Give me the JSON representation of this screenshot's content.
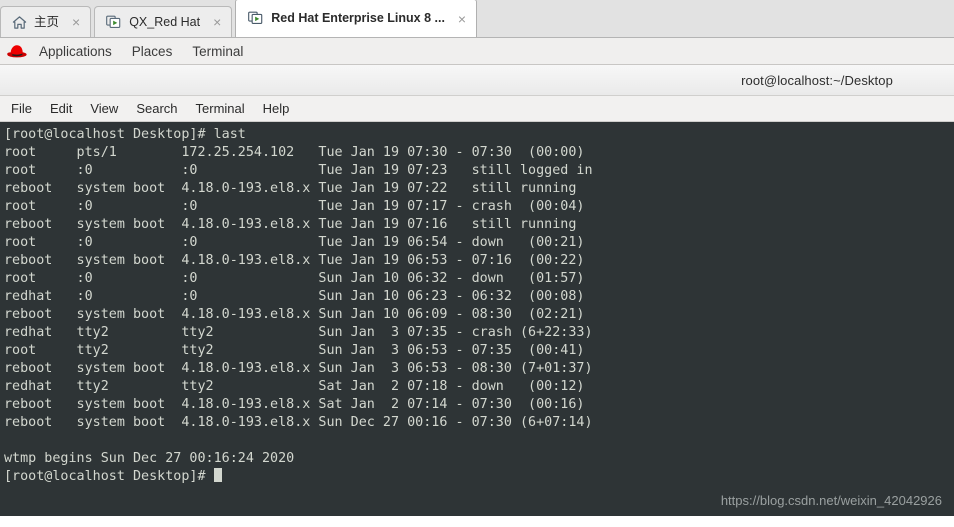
{
  "window": {
    "tabs": [
      {
        "label": "主页",
        "icon": "home-icon",
        "active": false,
        "close_label": "×"
      },
      {
        "label": "QX_Red Hat",
        "icon": "vm-screen-icon",
        "active": false,
        "close_label": "×"
      },
      {
        "label": "Red Hat Enterprise Linux 8 ...",
        "icon": "vm-screen-icon",
        "active": true,
        "close_label": "×"
      }
    ]
  },
  "gnome_panel": {
    "logo": "red-hat-logo",
    "items": [
      {
        "label": "Applications"
      },
      {
        "label": "Places"
      },
      {
        "label": "Terminal"
      }
    ]
  },
  "terminal_window": {
    "title": "root@localhost:~/Desktop",
    "menu": [
      {
        "label": "File"
      },
      {
        "label": "Edit"
      },
      {
        "label": "View"
      },
      {
        "label": "Search"
      },
      {
        "label": "Terminal"
      },
      {
        "label": "Help"
      }
    ]
  },
  "terminal": {
    "background_color": "#2e3436",
    "foreground_color": "#d3d7cf",
    "prompt": "[root@localhost Desktop]#",
    "command": "last",
    "lines": [
      "[root@localhost Desktop]# last",
      "root     pts/1        172.25.254.102   Tue Jan 19 07:30 - 07:30  (00:00)",
      "root     :0           :0               Tue Jan 19 07:23   still logged in",
      "reboot   system boot  4.18.0-193.el8.x Tue Jan 19 07:22   still running",
      "root     :0           :0               Tue Jan 19 07:17 - crash  (00:04)",
      "reboot   system boot  4.18.0-193.el8.x Tue Jan 19 07:16   still running",
      "root     :0           :0               Tue Jan 19 06:54 - down   (00:21)",
      "reboot   system boot  4.18.0-193.el8.x Tue Jan 19 06:53 - 07:16  (00:22)",
      "root     :0           :0               Sun Jan 10 06:32 - down   (01:57)",
      "redhat   :0           :0               Sun Jan 10 06:23 - 06:32  (00:08)",
      "reboot   system boot  4.18.0-193.el8.x Sun Jan 10 06:09 - 08:30  (02:21)",
      "redhat   tty2         tty2             Sun Jan  3 07:35 - crash (6+22:33)",
      "root     tty2         tty2             Sun Jan  3 06:53 - 07:35  (00:41)",
      "reboot   system boot  4.18.0-193.el8.x Sun Jan  3 06:53 - 08:30 (7+01:37)",
      "redhat   tty2         tty2             Sat Jan  2 07:18 - down   (00:12)",
      "reboot   system boot  4.18.0-193.el8.x Sat Jan  2 07:14 - 07:30  (00:16)",
      "reboot   system boot  4.18.0-193.el8.x Sun Dec 27 00:16 - 07:30 (6+07:14)",
      "",
      "wtmp begins Sun Dec 27 00:16:24 2020"
    ],
    "last_entries": [
      {
        "user": "root",
        "tty": "pts/1",
        "host": "172.25.254.102",
        "start": "Tue Jan 19 07:30",
        "end": "07:30",
        "duration": "(00:00)"
      },
      {
        "user": "root",
        "tty": ":0",
        "host": ":0",
        "start": "Tue Jan 19 07:23",
        "end": "still logged in",
        "duration": ""
      },
      {
        "user": "reboot",
        "tty": "system boot",
        "host": "4.18.0-193.el8.x",
        "start": "Tue Jan 19 07:22",
        "end": "still running",
        "duration": ""
      },
      {
        "user": "root",
        "tty": ":0",
        "host": ":0",
        "start": "Tue Jan 19 07:17",
        "end": "crash",
        "duration": "(00:04)"
      },
      {
        "user": "reboot",
        "tty": "system boot",
        "host": "4.18.0-193.el8.x",
        "start": "Tue Jan 19 07:16",
        "end": "still running",
        "duration": ""
      },
      {
        "user": "root",
        "tty": ":0",
        "host": ":0",
        "start": "Tue Jan 19 06:54",
        "end": "down",
        "duration": "(00:21)"
      },
      {
        "user": "reboot",
        "tty": "system boot",
        "host": "4.18.0-193.el8.x",
        "start": "Tue Jan 19 06:53",
        "end": "07:16",
        "duration": "(00:22)"
      },
      {
        "user": "root",
        "tty": ":0",
        "host": ":0",
        "start": "Sun Jan 10 06:32",
        "end": "down",
        "duration": "(01:57)"
      },
      {
        "user": "redhat",
        "tty": ":0",
        "host": ":0",
        "start": "Sun Jan 10 06:23",
        "end": "06:32",
        "duration": "(00:08)"
      },
      {
        "user": "reboot",
        "tty": "system boot",
        "host": "4.18.0-193.el8.x",
        "start": "Sun Jan 10 06:09",
        "end": "08:30",
        "duration": "(02:21)"
      },
      {
        "user": "redhat",
        "tty": "tty2",
        "host": "tty2",
        "start": "Sun Jan  3 07:35",
        "end": "crash",
        "duration": "(6+22:33)"
      },
      {
        "user": "root",
        "tty": "tty2",
        "host": "tty2",
        "start": "Sun Jan  3 06:53",
        "end": "07:35",
        "duration": "(00:41)"
      },
      {
        "user": "reboot",
        "tty": "system boot",
        "host": "4.18.0-193.el8.x",
        "start": "Sun Jan  3 06:53",
        "end": "08:30",
        "duration": "(7+01:37)"
      },
      {
        "user": "redhat",
        "tty": "tty2",
        "host": "tty2",
        "start": "Sat Jan  2 07:18",
        "end": "down",
        "duration": "(00:12)"
      },
      {
        "user": "reboot",
        "tty": "system boot",
        "host": "4.18.0-193.el8.x",
        "start": "Sat Jan  2 07:14",
        "end": "07:30",
        "duration": "(00:16)"
      },
      {
        "user": "reboot",
        "tty": "system boot",
        "host": "4.18.0-193.el8.x",
        "start": "Sun Dec 27 00:16",
        "end": "07:30",
        "duration": "(6+07:14)"
      }
    ],
    "footer": "wtmp begins Sun Dec 27 00:16:24 2020",
    "final_prompt": "[root@localhost Desktop]# "
  },
  "watermark": {
    "text": "https://blog.csdn.net/weixin_42042926"
  }
}
